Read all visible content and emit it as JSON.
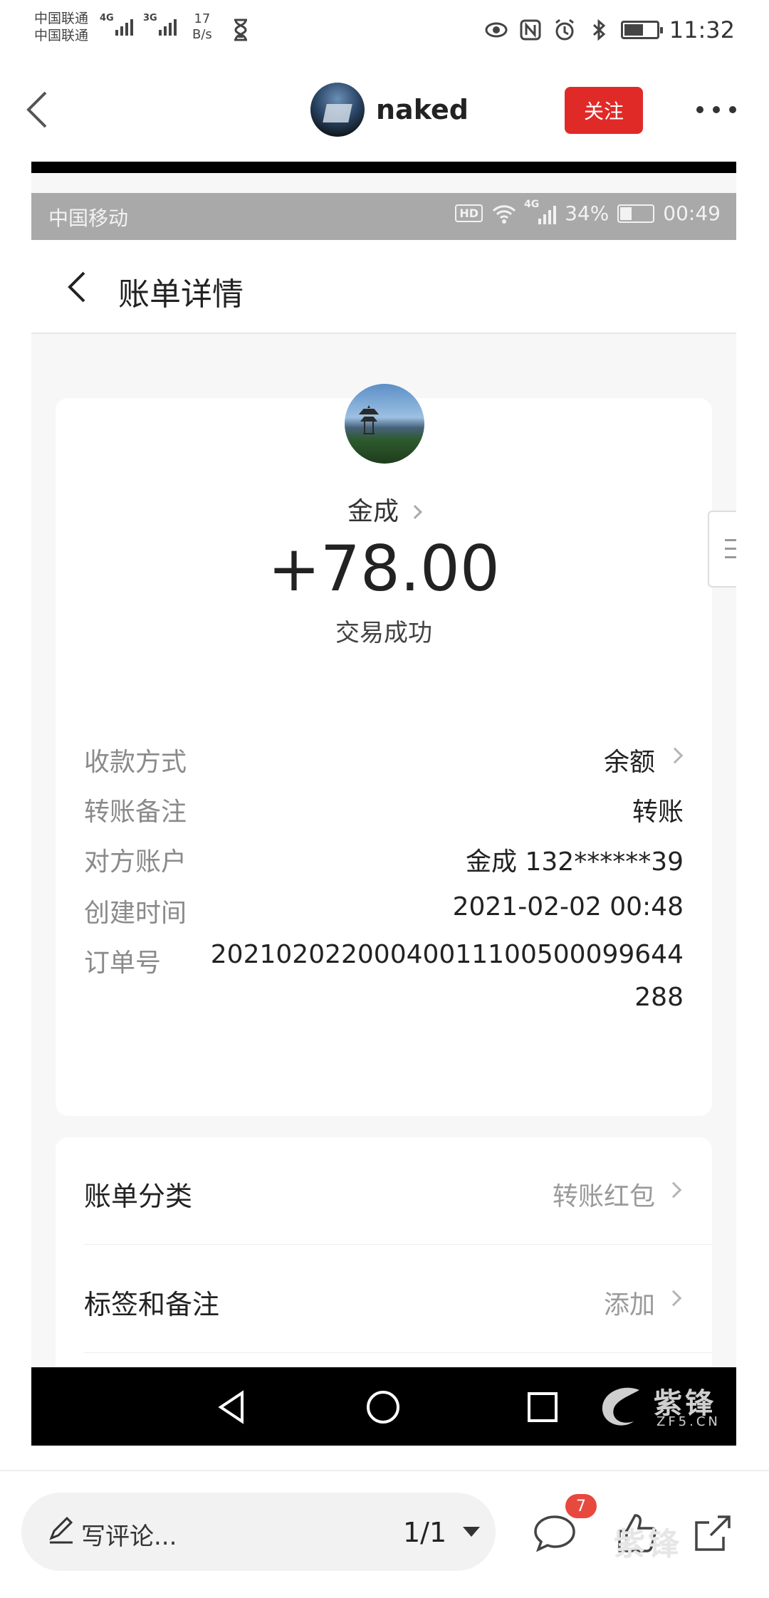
{
  "os_status": {
    "carrier_1": "中国联通",
    "carrier_2": "中国联通",
    "net_1": "4G",
    "net_2": "3G",
    "speed_value": "17",
    "speed_unit": "B/s",
    "time": "11:32"
  },
  "post_header": {
    "author_name": "naked",
    "follow_label": "关注"
  },
  "inner_status": {
    "carrier": "中国移动",
    "hd": "HD",
    "net": "4G",
    "battery_pct": "34%",
    "time": "00:49"
  },
  "inner_nav": {
    "title": "账单详情"
  },
  "bill": {
    "payer_name": "金成",
    "amount": "+78.00",
    "status": "交易成功",
    "rows": [
      {
        "label": "收款方式",
        "value": "余额"
      },
      {
        "label": "转账备注",
        "value": "转账"
      },
      {
        "label": "对方账户",
        "value": "金成 132******39"
      },
      {
        "label": "创建时间",
        "value": "2021-02-02 00:48"
      },
      {
        "label": "订单号",
        "value": "20210202200040011100500099644288"
      }
    ]
  },
  "extra": {
    "category_label": "账单分类",
    "category_value": "转账红包",
    "tags_label": "标签和备注",
    "tags_value": "添加"
  },
  "watermark": {
    "cn": "紫锋",
    "en": "ZF5.CN"
  },
  "bottom_bar": {
    "comment_placeholder": "写评论...",
    "pager": "1/1",
    "comment_count": "7"
  },
  "colors": {
    "follow_red": "#e02a27",
    "badge_red": "#e8493f",
    "inner_status_gray": "#a9a9a9"
  }
}
